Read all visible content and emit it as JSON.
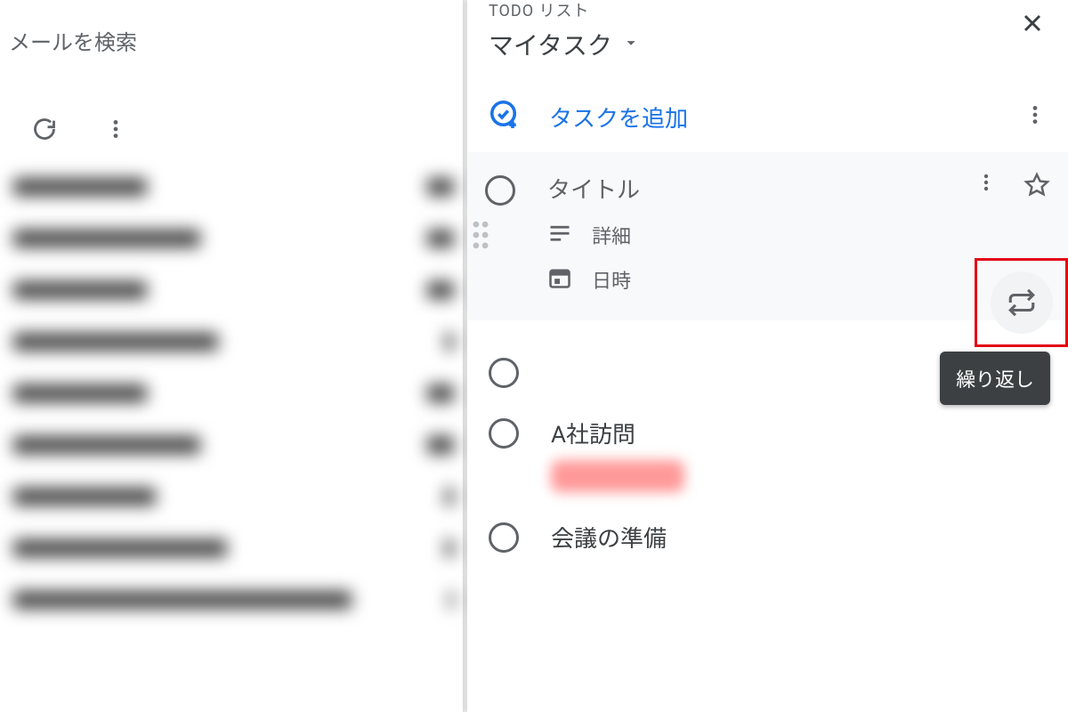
{
  "search": {
    "placeholder": "メールを検索"
  },
  "tasksPanel": {
    "subtitle": "TODO リスト",
    "listName": "マイタスク",
    "addTask": "タスクを追加",
    "editTask": {
      "titlePlaceholder": "タイトル",
      "detailsLabel": "詳細",
      "datetimeLabel": "日時"
    },
    "tasks": [
      {
        "title": ""
      },
      {
        "title": "A社訪問"
      },
      {
        "title": "会議の準備"
      }
    ],
    "repeatTooltip": "繰り返し"
  }
}
